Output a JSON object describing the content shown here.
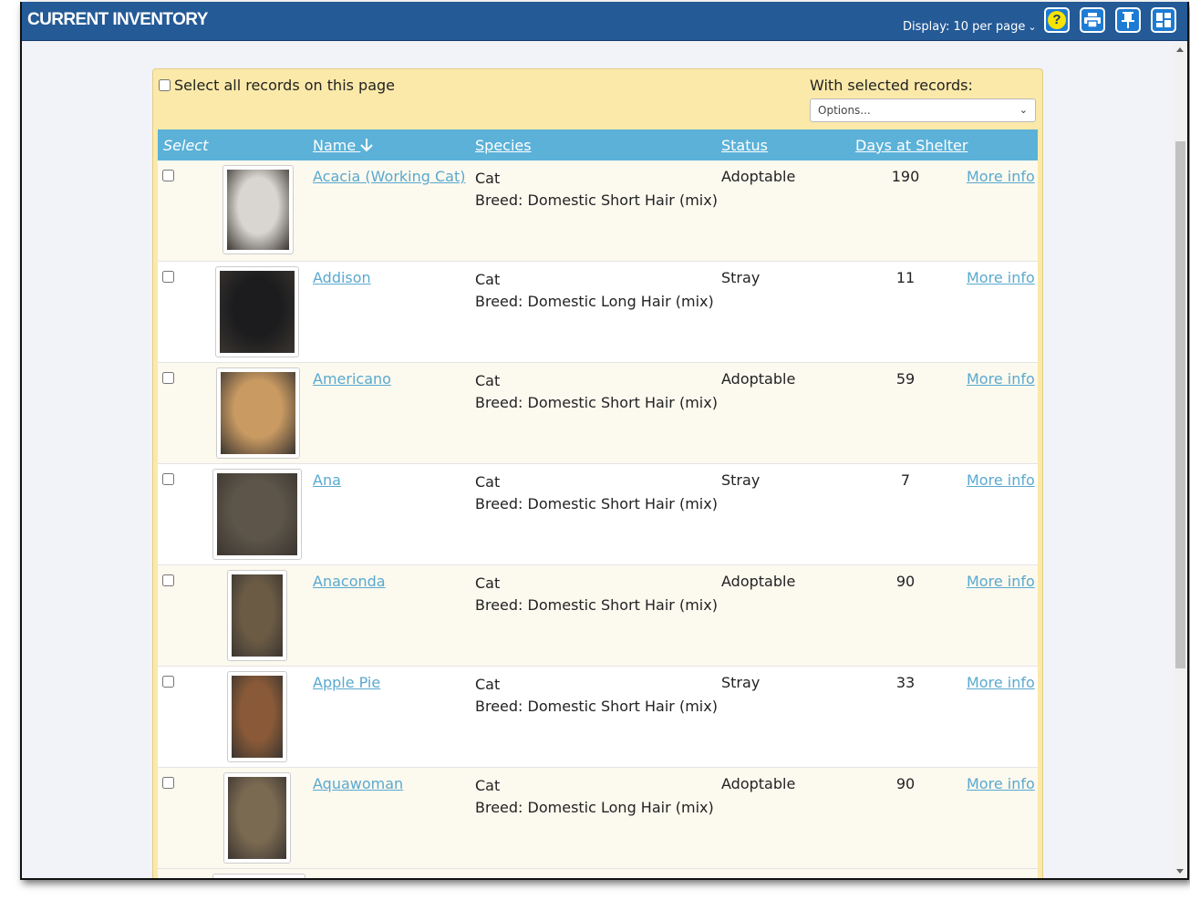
{
  "header": {
    "title": "CURRENT INVENTORY",
    "display_label": "Display: 10 per page",
    "help_label": "?"
  },
  "toolbar": {
    "select_all_label": "Select all records on this page",
    "with_selected_label": "With selected records:",
    "options_placeholder": "Options..."
  },
  "table": {
    "columns": {
      "select": "Select",
      "name": "Name",
      "species": "Species",
      "status": "Status",
      "days": "Days at Shelter"
    },
    "rows": [
      {
        "name": "Acacia (Working Cat)",
        "species": "Cat",
        "breed": "Breed: Domestic Short Hair (mix)",
        "status": "Adoptable",
        "days": "190",
        "more": "More info",
        "photo_color": "#d9d6d2"
      },
      {
        "name": "Addison",
        "species": "Cat",
        "breed": "Breed: Domestic Long Hair (mix)",
        "status": "Stray",
        "days": "11",
        "more": "More info",
        "photo_color": "#1c1c1e"
      },
      {
        "name": "Americano",
        "species": "Cat",
        "breed": "Breed: Domestic Short Hair (mix)",
        "status": "Adoptable",
        "days": "59",
        "more": "More info",
        "photo_color": "#c99a62"
      },
      {
        "name": "Ana",
        "species": "Cat",
        "breed": "Breed: Domestic Short Hair (mix)",
        "status": "Stray",
        "days": "7",
        "more": "More info",
        "photo_color": "#5d5549"
      },
      {
        "name": "Anaconda",
        "species": "Cat",
        "breed": "Breed: Domestic Short Hair (mix)",
        "status": "Adoptable",
        "days": "90",
        "more": "More info",
        "photo_color": "#6b5b45"
      },
      {
        "name": "Apple Pie",
        "species": "Cat",
        "breed": "Breed: Domestic Short Hair (mix)",
        "status": "Stray",
        "days": "33",
        "more": "More info",
        "photo_color": "#8a5a38"
      },
      {
        "name": "Aquawoman",
        "species": "Cat",
        "breed": "Breed: Domestic Long Hair (mix)",
        "status": "Adoptable",
        "days": "90",
        "more": "More info",
        "photo_color": "#7b6a52"
      }
    ]
  },
  "colors": {
    "header_bg": "#245a96",
    "panel_bg": "#fbe9a9",
    "table_header_bg": "#5bb1d8",
    "link": "#5aa9cf"
  }
}
